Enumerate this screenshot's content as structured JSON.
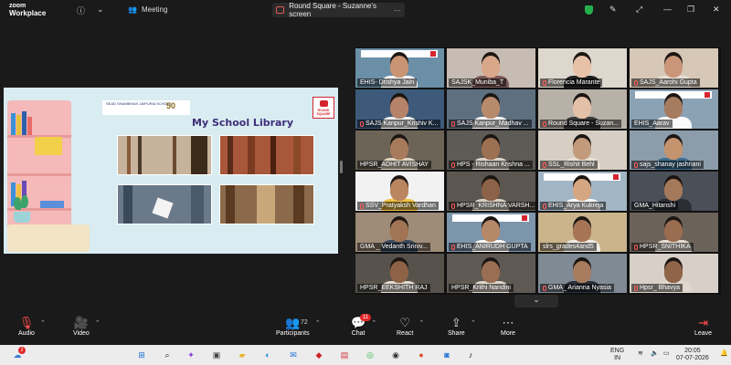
{
  "app": {
    "logo_line1": "zoom",
    "logo_line2": "Workplace",
    "meeting_label": "Meeting",
    "share_tab_label": "Round Square - Suzanne's screen"
  },
  "slide": {
    "title": "My School Library",
    "school_name": "SEAD SHAMBHAVI JAIPURIA SCHOOL",
    "anniversary": "50",
    "partner_logo": "ROUND SQUARE"
  },
  "participants": [
    {
      "name": "EHIS- Drishya Jain",
      "muted": false,
      "banner": true,
      "skin": "#c99474",
      "bg": "#6b8fa6",
      "shirt": "#fafafa"
    },
    {
      "name": "SAJSK_Muniba_T",
      "muted": false,
      "banner": false,
      "skin": "#d9a88b",
      "bg": "#c7bcb3",
      "shirt": "#7e5a5a"
    },
    {
      "name": "Florencia Marante",
      "muted": true,
      "banner": false,
      "skin": "#e8c2a8",
      "bg": "#ded7cd",
      "shirt": "#222"
    },
    {
      "name": "SAJS_Aarohi Gupta",
      "muted": true,
      "banner": false,
      "skin": "#c9967a",
      "bg": "#d6c7b6",
      "shirt": "#e8e0d6"
    },
    {
      "name": "SAJS Kanpur_Krishiv K...",
      "muted": true,
      "banner": false,
      "skin": "#b5826a",
      "bg": "#3d5a7a",
      "shirt": "#f0f0f0"
    },
    {
      "name": "SAJS Kanpur_Madhav ...",
      "muted": true,
      "banner": false,
      "skin": "#b88a6c",
      "bg": "#5e7080",
      "shirt": "#fafafa"
    },
    {
      "name": "Round Square - Suzan...",
      "muted": true,
      "banner": false,
      "skin": "#e3c0a8",
      "bg": "#b8b1a8",
      "shirt": "#3a3a3a"
    },
    {
      "name": "EHIS_Aarav",
      "muted": false,
      "banner": true,
      "skin": "#a67c60",
      "bg": "#8ba2b5",
      "shirt": "#fafafa"
    },
    {
      "name": "HPSR_ADHIT AVISHAY",
      "muted": false,
      "banner": false,
      "skin": "#a77a5c",
      "bg": "#6c6557",
      "shirt": "#e3d7c2"
    },
    {
      "name": "HPS - Rishaan Krishna ...",
      "muted": true,
      "banner": false,
      "skin": "#9c7052",
      "bg": "#5d5b55",
      "shirt": "#dcd5c8"
    },
    {
      "name": "SSL_Rishit Behl",
      "muted": true,
      "banner": false,
      "skin": "#c29a7c",
      "bg": "#d8cfc4",
      "shirt": "#e8e0d0"
    },
    {
      "name": "sajs_shanay jashnani",
      "muted": true,
      "banner": false,
      "skin": "#c4946f",
      "bg": "#8c9cab",
      "shirt": "#3e6e8e",
      "active": true
    },
    {
      "name": "SSV_Pratyaksh Vardhan",
      "muted": true,
      "banner": false,
      "skin": "#b9865f",
      "bg": "#f2f2f2",
      "shirt": "#f0c040"
    },
    {
      "name": "HPSR_KRISHNA VARSH...",
      "muted": true,
      "banner": false,
      "skin": "#8c6248",
      "bg": "#5b5650",
      "shirt": "#d8d0c4"
    },
    {
      "name": "EHIS_Arya Kukreja",
      "muted": true,
      "banner": true,
      "skin": "#d4a682",
      "bg": "#a2b5c4",
      "shirt": "#fafafa"
    },
    {
      "name": "GMA_Hitanshi",
      "muted": false,
      "banner": false,
      "skin": "#a57a5c",
      "bg": "#4a4f58",
      "shirt": "#2b2d34"
    },
    {
      "name": "GMA _ Vedanth Sriniv...",
      "muted": false,
      "banner": false,
      "skin": "#a07454",
      "bg": "#9e8c78",
      "shirt": "#3d4a5c"
    },
    {
      "name": "EHIS_ANIRUDH GUPTA",
      "muted": true,
      "banner": true,
      "skin": "#b58867",
      "bg": "#7d95aa",
      "shirt": "#fafafa"
    },
    {
      "name": "slrs_grades4and5",
      "muted": false,
      "banner": false,
      "skin": "#a57555",
      "bg": "#c9b48c",
      "shirt": "#f0ece4"
    },
    {
      "name": "HPSR_SNITHIKA",
      "muted": true,
      "banner": false,
      "skin": "#9a6c50",
      "bg": "#6b625a",
      "shirt": "#e5ddd0"
    },
    {
      "name": "HPSR_EEKSHITH RAJ",
      "muted": false,
      "banner": false,
      "skin": "#8e6246",
      "bg": "#57524c",
      "shirt": "#e3dace"
    },
    {
      "name": "HPSR_Krithi Nandini",
      "muted": false,
      "banner": false,
      "skin": "#9a6e52",
      "bg": "#5e5953",
      "shirt": "#dfd6c9"
    },
    {
      "name": "GMA_ Arianna Nyasia",
      "muted": true,
      "banner": false,
      "skin": "#a87c5e",
      "bg": "#7f8a95",
      "shirt": "#2a2f3a"
    },
    {
      "name": "Hpsr_ Bhavya",
      "muted": true,
      "banner": false,
      "skin": "#8f6448",
      "bg": "#d8d0c8",
      "shirt": "#e0d8cc"
    }
  ],
  "toolbar": {
    "audio": "Audio",
    "video": "Video",
    "participants": "Participants",
    "participants_count": "72",
    "chat": "Chat",
    "chat_badge": "11",
    "react": "React",
    "share": "Share",
    "more": "More",
    "leave": "Leave"
  },
  "taskbar": {
    "weather_badge": "2",
    "lang_line1": "ENG",
    "lang_line2": "IN",
    "time": "20:05",
    "date": "07-07-2026"
  },
  "colors": {
    "active_speaker": "#2ed158",
    "leave": "#ff4d4d",
    "badge": "#e02828",
    "slide_bg": "#d8ecf1"
  }
}
